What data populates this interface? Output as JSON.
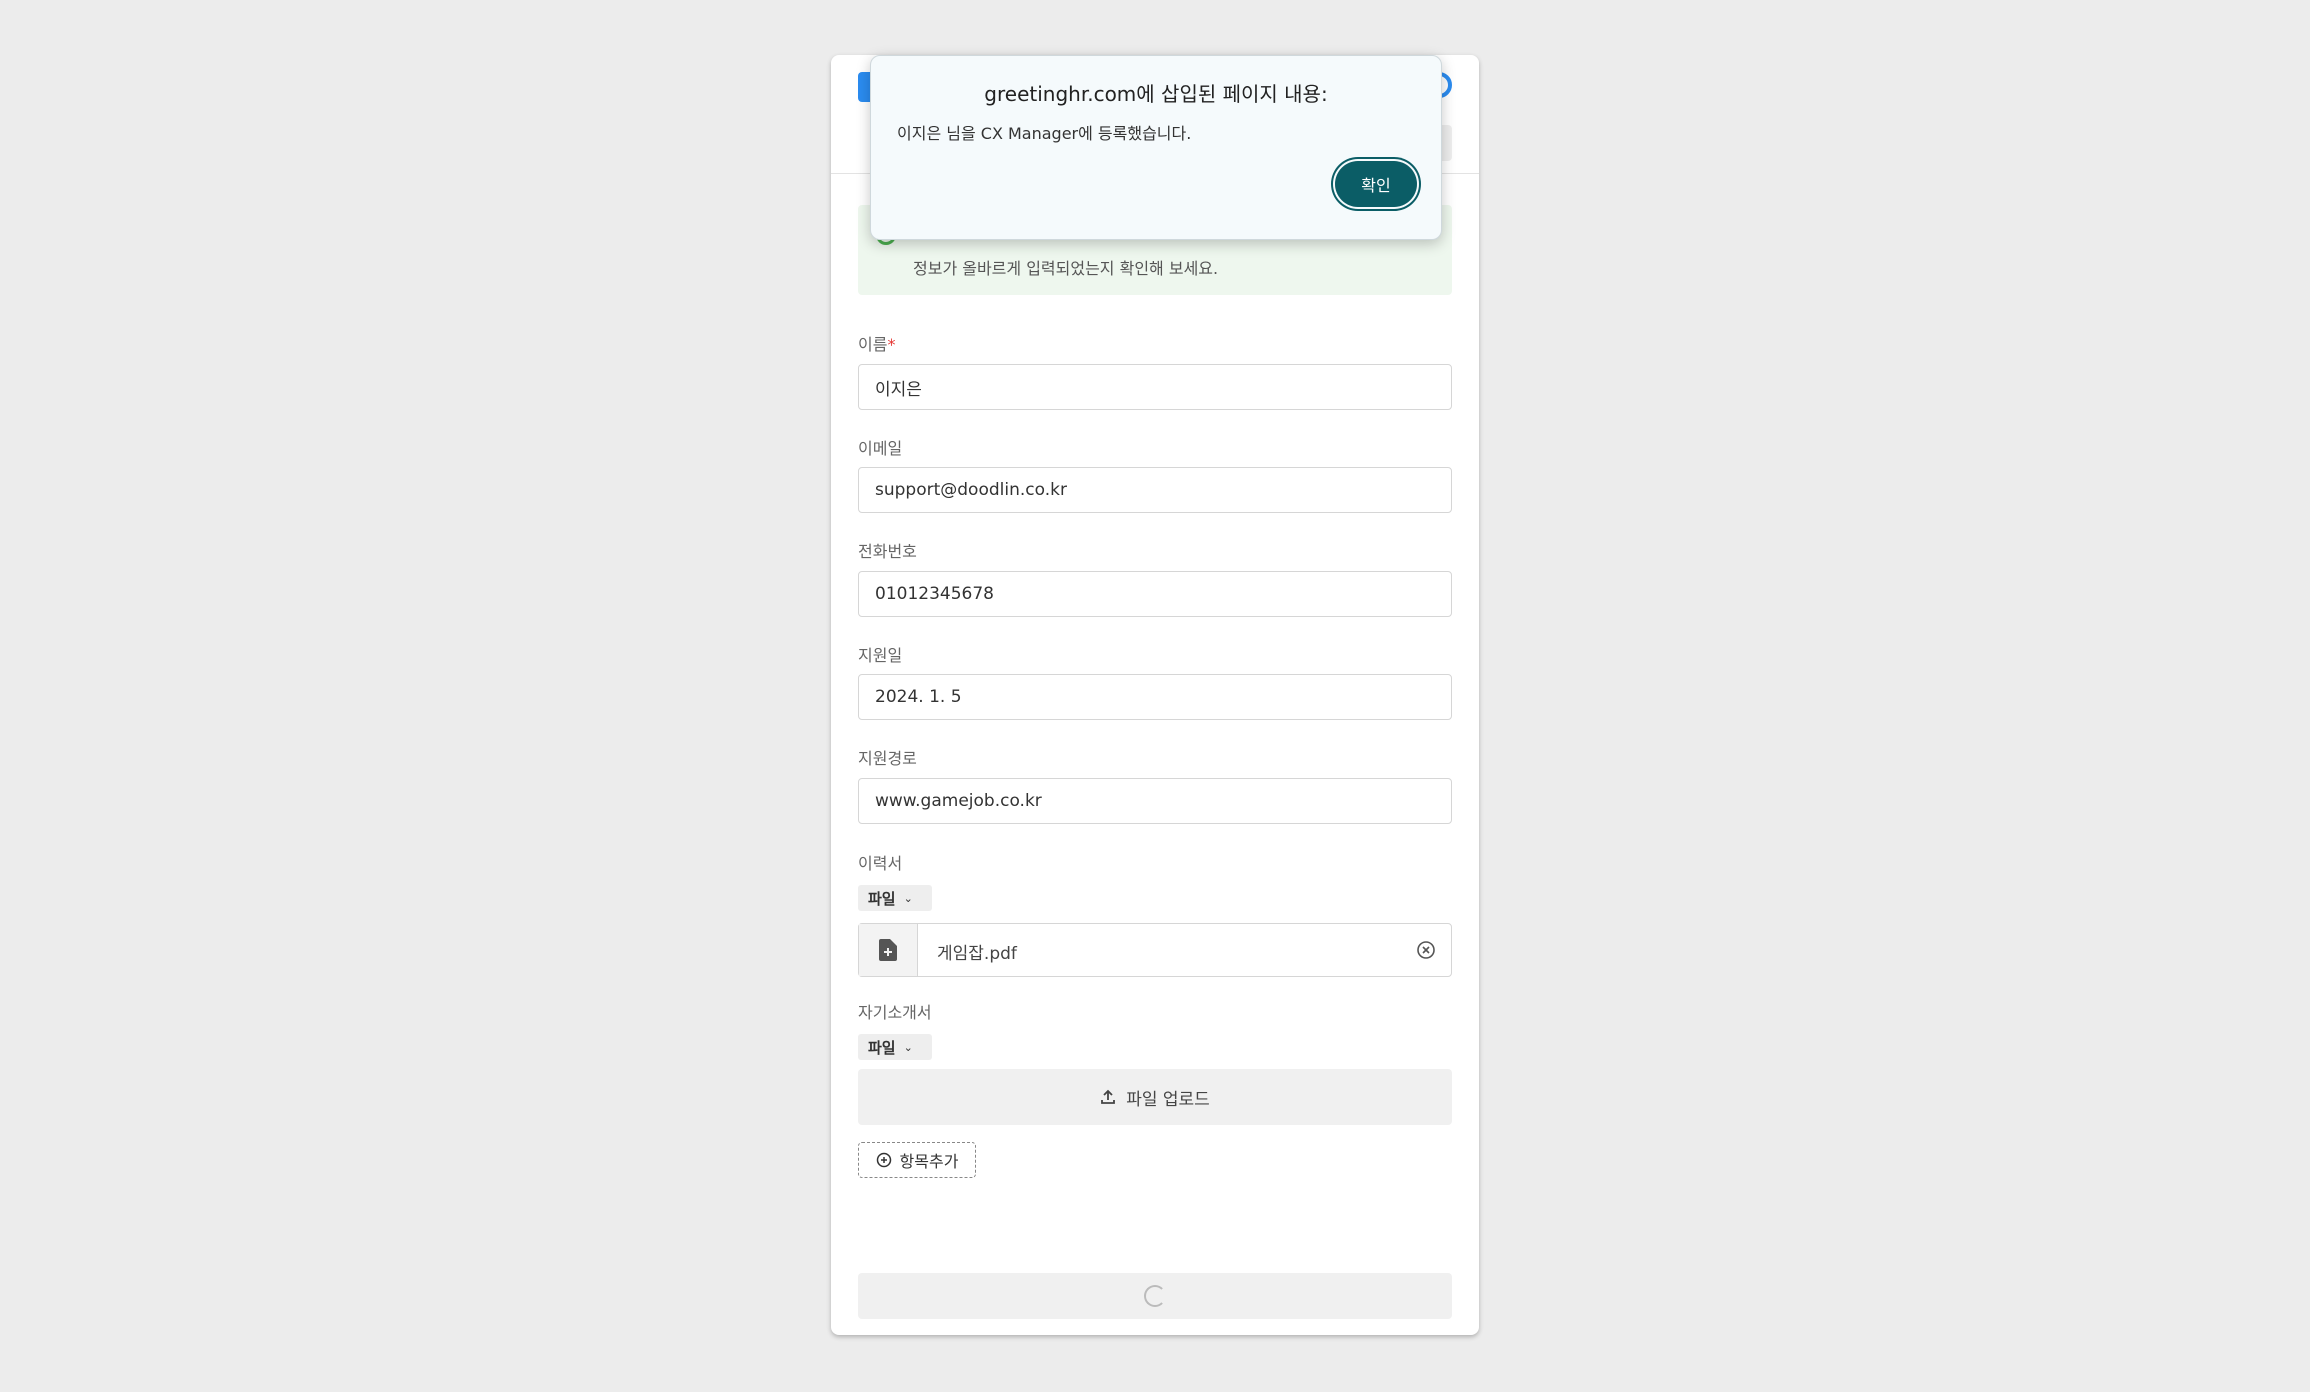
{
  "form": {
    "notice_line2": "정보가 올바르게 입력되었는지 확인해 보세요.",
    "fields": {
      "name": {
        "label": "이름",
        "required_mark": "*",
        "value": "이지은"
      },
      "email": {
        "label": "이메일",
        "value": "support@doodlin.co.kr"
      },
      "phone": {
        "label": "전화번호",
        "value": "01012345678"
      },
      "apply_date": {
        "label": "지원일",
        "value": "2024. 1. 5"
      },
      "source": {
        "label": "지원경로",
        "value": "www.gamejob.co.kr"
      }
    },
    "resume": {
      "label": "이력서",
      "type": "파일",
      "file_name": "게임잡.pdf"
    },
    "cover_letter": {
      "label": "자기소개서",
      "type": "파일",
      "upload_label": "파일 업로드"
    },
    "add_item_label": "항목추가"
  },
  "dialog": {
    "title": "greetinghr.com에 삽입된 페이지 내용:",
    "message": "이지은 님을 CX Manager에 등록했습니다.",
    "ok_label": "확인"
  },
  "colors": {
    "accent": "#2b8cf0",
    "dialog_button": "#0b5d66",
    "notice_bg": "#eef7ee",
    "required": "#e53935"
  }
}
